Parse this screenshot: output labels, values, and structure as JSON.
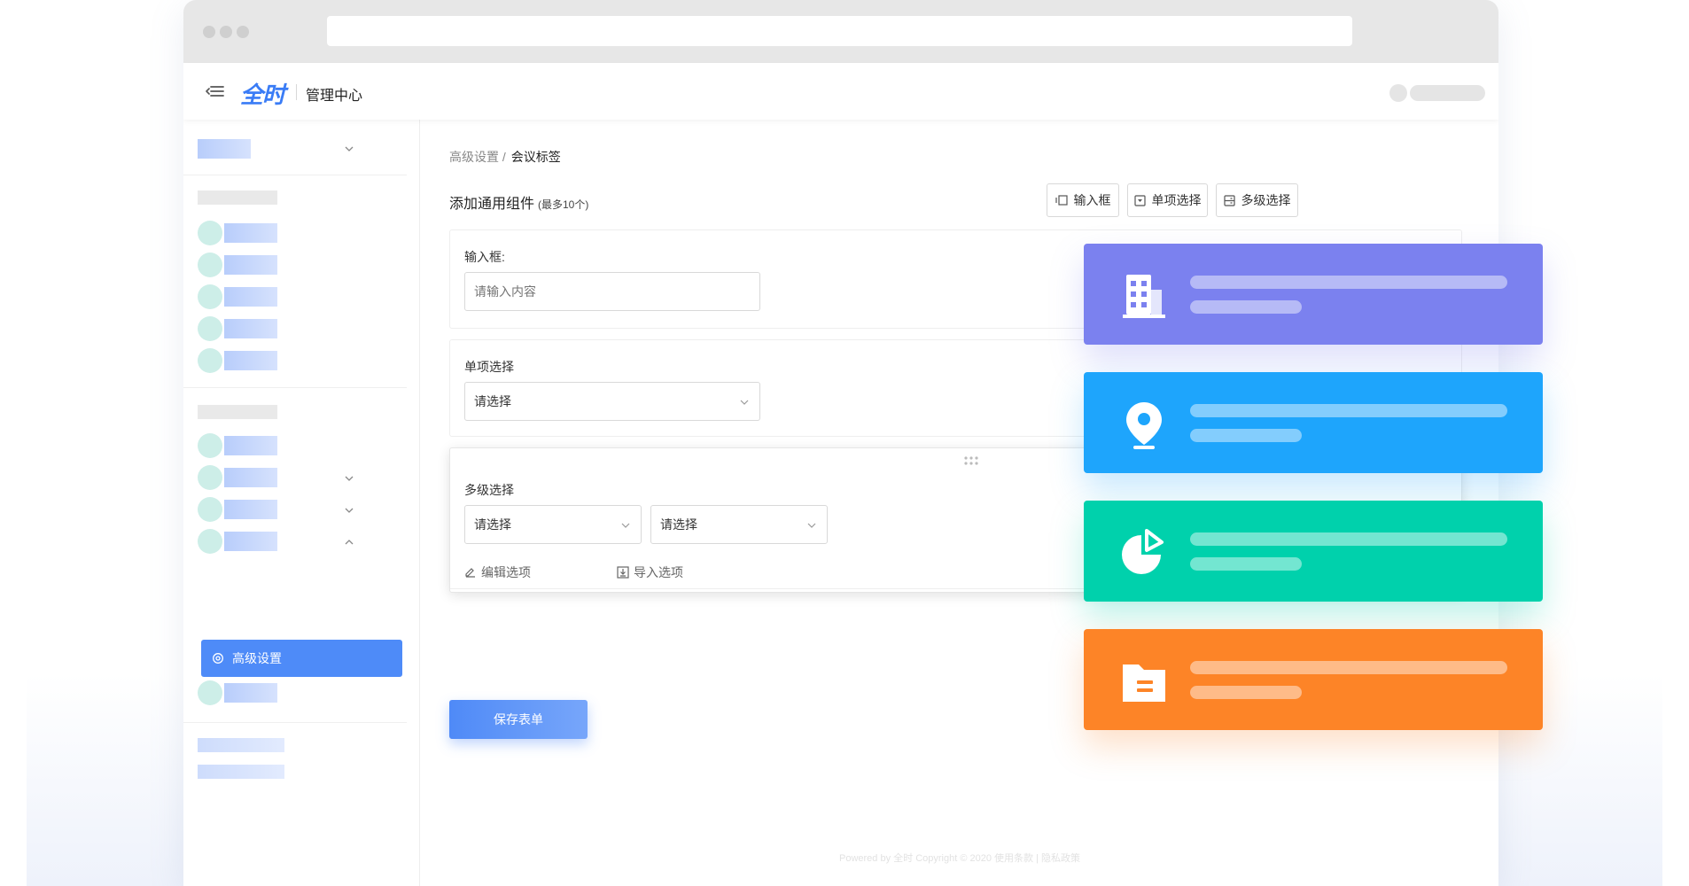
{
  "appbar": {
    "logo_text": "全时",
    "title": "管理中心"
  },
  "sidebar": {
    "active_item": {
      "label": "高级设置",
      "icon": "gear-icon"
    }
  },
  "breadcrumb": {
    "parent": "高级设置 /",
    "current": "会议标签"
  },
  "section": {
    "title": "添加通用组件",
    "note": "(最多10个)"
  },
  "toolbar": {
    "buttons": [
      {
        "label": "输入框",
        "icon": "input-box-icon"
      },
      {
        "label": "单项选择",
        "icon": "single-select-icon"
      },
      {
        "label": "多级选择",
        "icon": "multi-select-icon"
      }
    ]
  },
  "form": {
    "input_card": {
      "label": "输入框:",
      "placeholder": "请输入内容"
    },
    "single_card": {
      "label": "单项选择",
      "select_value": "请选择"
    },
    "multi_card": {
      "label": "多级选择",
      "select1_value": "请选择",
      "select2_value": "请选择",
      "edit_options": "编辑选项",
      "import_options": "导入选项"
    },
    "save_label": "保存表单"
  },
  "footer": {
    "text": "Powered by 全时   Copyright © 2020    使用条款  |  隐私政策"
  },
  "float_cards": [
    {
      "color": "#7b81ef",
      "icon": "building-icon"
    },
    {
      "color": "#1ea5fc",
      "icon": "location-pin-icon"
    },
    {
      "color": "#00d1ac",
      "icon": "pie-chart-icon"
    },
    {
      "color": "#fd8427",
      "icon": "document-folder-icon"
    }
  ]
}
